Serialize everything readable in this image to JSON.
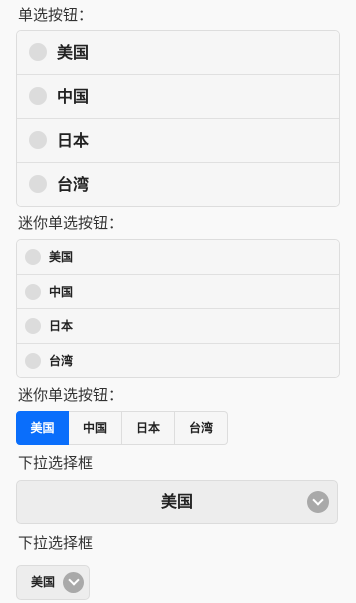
{
  "section1": {
    "label": "单选按钮：",
    "options": [
      "美国",
      "中国",
      "日本",
      "台湾"
    ]
  },
  "section2": {
    "label": "迷你单选按钮：",
    "options": [
      "美国",
      "中国",
      "日本",
      "台湾"
    ]
  },
  "section3": {
    "label": "迷你单选按钮：",
    "options": [
      "美国",
      "中国",
      "日本",
      "台湾"
    ],
    "selected": "美国"
  },
  "section4": {
    "label": "下拉选择框",
    "selected_value": "美国"
  },
  "section5": {
    "label": "下拉选择框",
    "selected_value": "美国"
  },
  "colors": {
    "accent": "#0a6efb",
    "radio": "#dcdcdc"
  }
}
